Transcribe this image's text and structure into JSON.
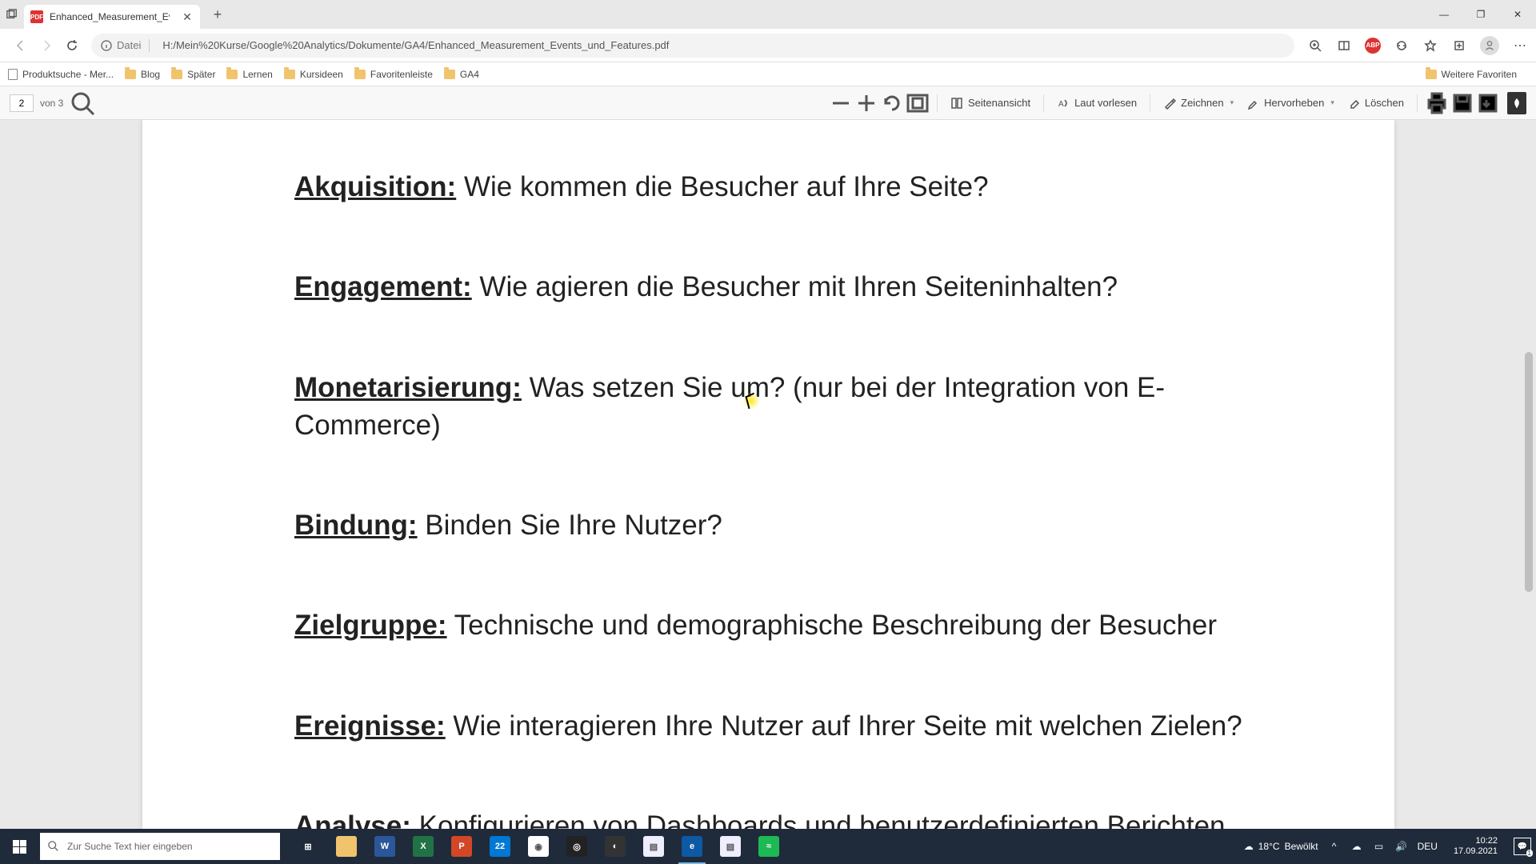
{
  "window": {
    "minimize": "—",
    "maximize": "❐",
    "close": "✕"
  },
  "tab": {
    "title": "Enhanced_Measurement_Events",
    "favicon_text": "PDF"
  },
  "address": {
    "scheme": "Datei",
    "url": "H:/Mein%20Kurse/Google%20Analytics/Dokumente/GA4/Enhanced_Measurement_Events_und_Features.pdf"
  },
  "bookmarks": [
    {
      "icon": "doc",
      "label": "Produktsuche - Mer..."
    },
    {
      "icon": "folder",
      "label": "Blog"
    },
    {
      "icon": "folder",
      "label": "Später"
    },
    {
      "icon": "folder",
      "label": "Lernen"
    },
    {
      "icon": "folder",
      "label": "Kursideen"
    },
    {
      "icon": "folder",
      "label": "Favoritenleiste"
    },
    {
      "icon": "folder",
      "label": "GA4"
    }
  ],
  "bookmarks_overflow": "Weitere Favoriten",
  "pdf_toolbar": {
    "page_current": "2",
    "page_of": "von 3",
    "page_view": "Seitenansicht",
    "read_aloud": "Laut vorlesen",
    "draw": "Zeichnen",
    "highlight": "Hervorheben",
    "erase": "Löschen"
  },
  "document": {
    "entries": [
      {
        "term": "Akquisition:",
        "text": " Wie kommen die Besucher auf Ihre Seite?"
      },
      {
        "term": "Engagement:",
        "text": " Wie agieren die Besucher mit Ihren Seiteninhalten?"
      },
      {
        "term": "Monetarisierung:",
        "text": " Was setzen Sie um? (nur bei der Integration von E-Commerce)"
      },
      {
        "term": "Bindung:",
        "text": " Binden Sie Ihre Nutzer?"
      },
      {
        "term": "Zielgruppe:",
        "text": " Technische und demographische Beschreibung der Besucher"
      },
      {
        "term": "Ereignisse:",
        "text": " Wie interagieren Ihre Nutzer auf Ihrer Seite mit welchen Zielen?"
      },
      {
        "term": "Analyse:",
        "text": " Konfigurieren von Dashboards und benutzerdefinierten Berichten"
      }
    ]
  },
  "taskbar": {
    "search_placeholder": "Zur Suche Text hier eingeben",
    "apps": [
      {
        "name": "task-view",
        "bg": "transparent",
        "text": "",
        "glyph": "⊞"
      },
      {
        "name": "explorer",
        "bg": "#f0c36d",
        "text": ""
      },
      {
        "name": "word",
        "bg": "#2b579a",
        "text": "W"
      },
      {
        "name": "excel",
        "bg": "#217346",
        "text": "X"
      },
      {
        "name": "powerpoint",
        "bg": "#d24726",
        "text": "P"
      },
      {
        "name": "mail",
        "bg": "#0078d4",
        "text": "22"
      },
      {
        "name": "chrome",
        "bg": "#fff",
        "text": "",
        "glyph": "◉"
      },
      {
        "name": "obs",
        "bg": "#222",
        "text": "",
        "glyph": "◎"
      },
      {
        "name": "app-orange",
        "bg": "#333",
        "text": "",
        "glyph": "◐"
      },
      {
        "name": "notepad-1",
        "bg": "#eef",
        "text": "",
        "glyph": "▤"
      },
      {
        "name": "edge",
        "bg": "#0c59a4",
        "text": "",
        "glyph": "e",
        "active": true
      },
      {
        "name": "notepad-2",
        "bg": "#eef",
        "text": "",
        "glyph": "▤"
      },
      {
        "name": "spotify",
        "bg": "#1db954",
        "text": "",
        "glyph": "≈"
      }
    ],
    "weather": {
      "temp": "18°C",
      "desc": "Bewölkt"
    },
    "lang": "DEU",
    "time": "10:22",
    "date": "17.09.2021",
    "notif_count": "1"
  }
}
